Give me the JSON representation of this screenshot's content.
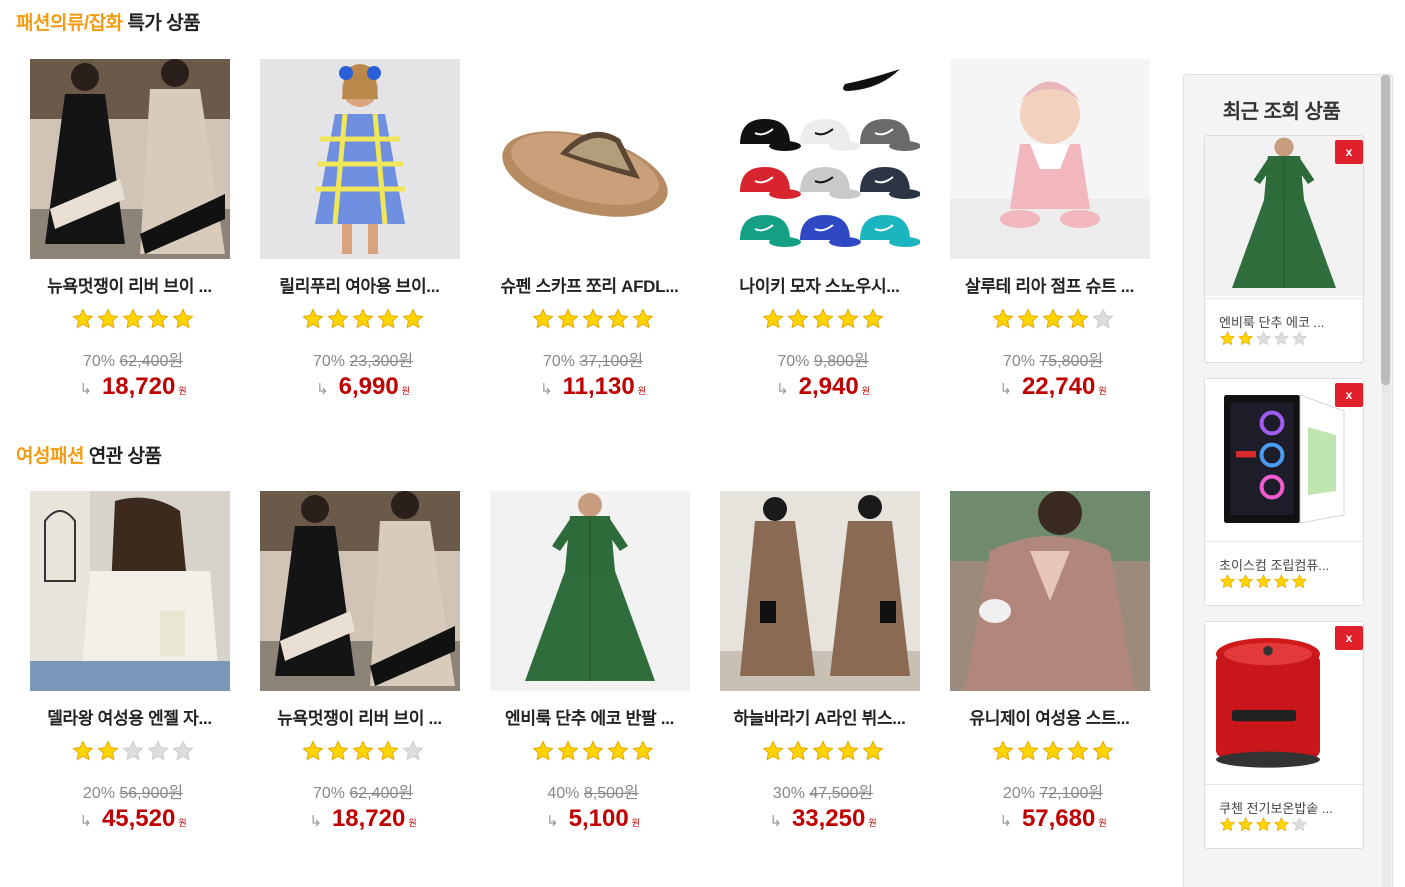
{
  "section1": {
    "highlight": "패션의류/잡화",
    "rest": " 특가 상품"
  },
  "section2": {
    "highlight": "여성패션",
    "rest": " 연관 상품"
  },
  "products1": [
    {
      "name": "뉴욕멋쟁이 리버 브이 ...",
      "rating": 5,
      "discount": "70%",
      "original": "62,400원",
      "price": "18,720",
      "won": "원",
      "arrow": "↳",
      "image": "black-beige-dress"
    },
    {
      "name": "릴리푸리 여아용 브이...",
      "rating": 5,
      "discount": "70%",
      "original": "23,300원",
      "price": "6,990",
      "won": "원",
      "arrow": "↳",
      "image": "girl-check-dress"
    },
    {
      "name": "슈펜 스카프 쪼리 AFDL...",
      "rating": 5,
      "discount": "70%",
      "original": "37,100원",
      "price": "11,130",
      "won": "원",
      "arrow": "↳",
      "image": "flip-flop-sandal"
    },
    {
      "name": "나이키 모자 스노우시...",
      "rating": 5,
      "discount": "70%",
      "original": "9,800원",
      "price": "2,940",
      "won": "원",
      "arrow": "↳",
      "image": "nike-caps"
    },
    {
      "name": "살루테 리아 점프 슈트 ...",
      "rating": 4,
      "discount": "70%",
      "original": "75,800원",
      "price": "22,740",
      "won": "원",
      "arrow": "↳",
      "image": "baby-jumpsuit"
    }
  ],
  "products2": [
    {
      "name": "델라왕 여성용 엔젤 자...",
      "rating": 2,
      "discount": "20%",
      "original": "56,900원",
      "price": "45,520",
      "won": "원",
      "arrow": "↳",
      "image": "white-blouse"
    },
    {
      "name": "뉴욕멋쟁이 리버 브이 ...",
      "rating": 4,
      "discount": "70%",
      "original": "62,400원",
      "price": "18,720",
      "won": "원",
      "arrow": "↳",
      "image": "black-beige-dress"
    },
    {
      "name": "엔비룩 단추 에코 반팔 ...",
      "rating": 5,
      "discount": "40%",
      "original": "8,500원",
      "price": "5,100",
      "won": "원",
      "arrow": "↳",
      "image": "green-dress"
    },
    {
      "name": "하늘바라기 A라인 뷔스...",
      "rating": 5,
      "discount": "30%",
      "original": "47,500원",
      "price": "33,250",
      "won": "원",
      "arrow": "↳",
      "image": "brown-bustier-dress"
    },
    {
      "name": "유니제이 여성용 스트...",
      "rating": 5,
      "discount": "20%",
      "original": "72,100원",
      "price": "57,680",
      "won": "원",
      "arrow": "↳",
      "image": "pink-blouse"
    }
  ],
  "sidebar": {
    "title": "최근 조회 상품",
    "close_label": "x",
    "items": [
      {
        "name": "엔비룩 단추 에코 ...",
        "rating": 2,
        "image": "green-dress"
      },
      {
        "name": "초이스컴 조립컴퓨...",
        "rating": 5,
        "image": "pc-case"
      },
      {
        "name": "쿠첸 전기보온밥솥 ...",
        "rating": 4,
        "image": "rice-cooker"
      }
    ]
  },
  "colors": {
    "highlight": "#f39c12",
    "price": "#c00000",
    "star": "#ffd400",
    "star_empty": "#dddddd",
    "close": "#e0202a"
  }
}
